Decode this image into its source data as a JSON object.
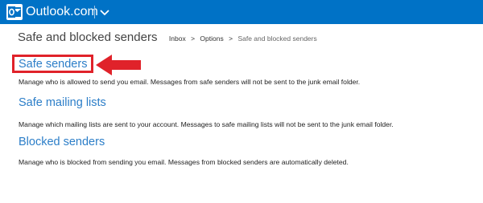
{
  "header": {
    "brand": "Outlook.com",
    "logo_icon": "outlook-logo-icon",
    "menu_icon": "chevron-down-icon",
    "bar_color": "#0072c6"
  },
  "page": {
    "title": "Safe and blocked senders",
    "breadcrumb": {
      "inbox": "Inbox",
      "separator": ">",
      "options": "Options",
      "current": "Safe and blocked senders"
    }
  },
  "sections": [
    {
      "title": "Safe senders",
      "description": "Manage who is allowed to send you email. Messages from safe senders will not be sent to the junk email folder."
    },
    {
      "title": "Safe mailing lists",
      "description": "Manage which mailing lists are sent to your account. Messages to safe mailing lists will not be sent to the junk email folder."
    },
    {
      "title": "Blocked senders",
      "description": "Manage who is blocked from sending you email. Messages from blocked senders are automatically deleted."
    }
  ],
  "annotation": {
    "highlight_color": "#e0222a",
    "arrow_icon": "left-arrow-icon"
  },
  "link_color": "#2c7ec8"
}
